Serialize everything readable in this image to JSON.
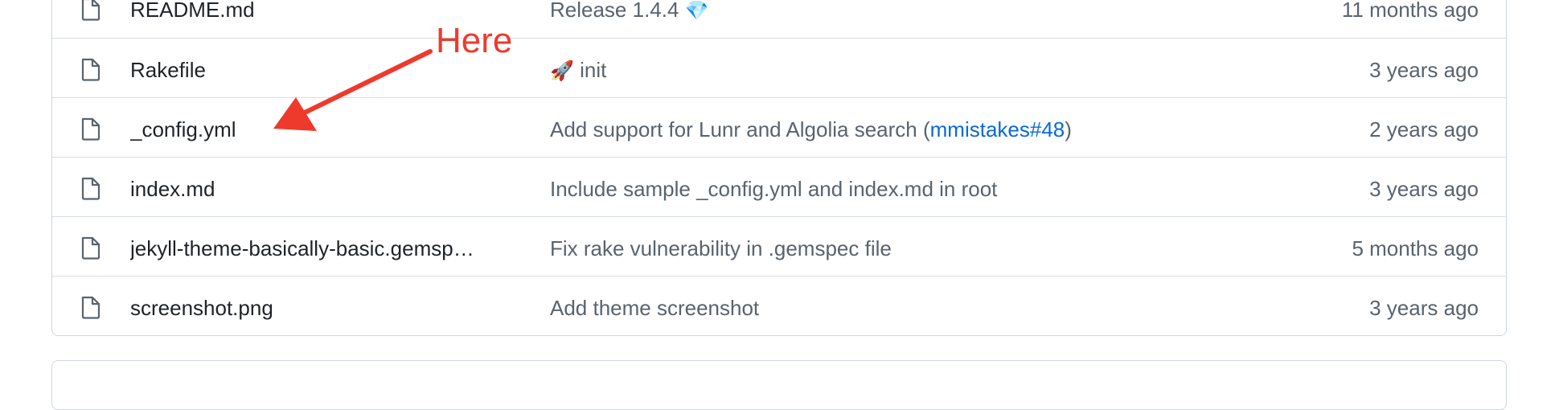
{
  "files": [
    {
      "name": "README.md",
      "message_prefix": "Release 1.4.4 ",
      "message_emoji": "💎",
      "message_link": "",
      "message_suffix": "",
      "age": "11 months ago"
    },
    {
      "name": "Rakefile",
      "message_prefix": " init",
      "message_emoji": "🚀",
      "message_link": "",
      "message_suffix": "",
      "age": "3 years ago"
    },
    {
      "name": "_config.yml",
      "message_prefix": "Add support for Lunr and Algolia search (",
      "message_emoji": "",
      "message_link": "mmistakes#48",
      "message_suffix": ")",
      "age": "2 years ago"
    },
    {
      "name": "index.md",
      "message_prefix": "Include sample _config.yml and index.md in root",
      "message_emoji": "",
      "message_link": "",
      "message_suffix": "",
      "age": "3 years ago"
    },
    {
      "name": "jekyll-theme-basically-basic.gemsp…",
      "message_prefix": "Fix rake vulnerability in .gemspec file",
      "message_emoji": "",
      "message_link": "",
      "message_suffix": "",
      "age": "5 months ago"
    },
    {
      "name": "screenshot.png",
      "message_prefix": "Add theme screenshot",
      "message_emoji": "",
      "message_link": "",
      "message_suffix": "",
      "age": "3 years ago"
    }
  ],
  "annotation": {
    "label": "Here",
    "color": "#ee3a2c"
  },
  "icons": {
    "file": "file-icon",
    "arrow": "arrow-icon"
  }
}
